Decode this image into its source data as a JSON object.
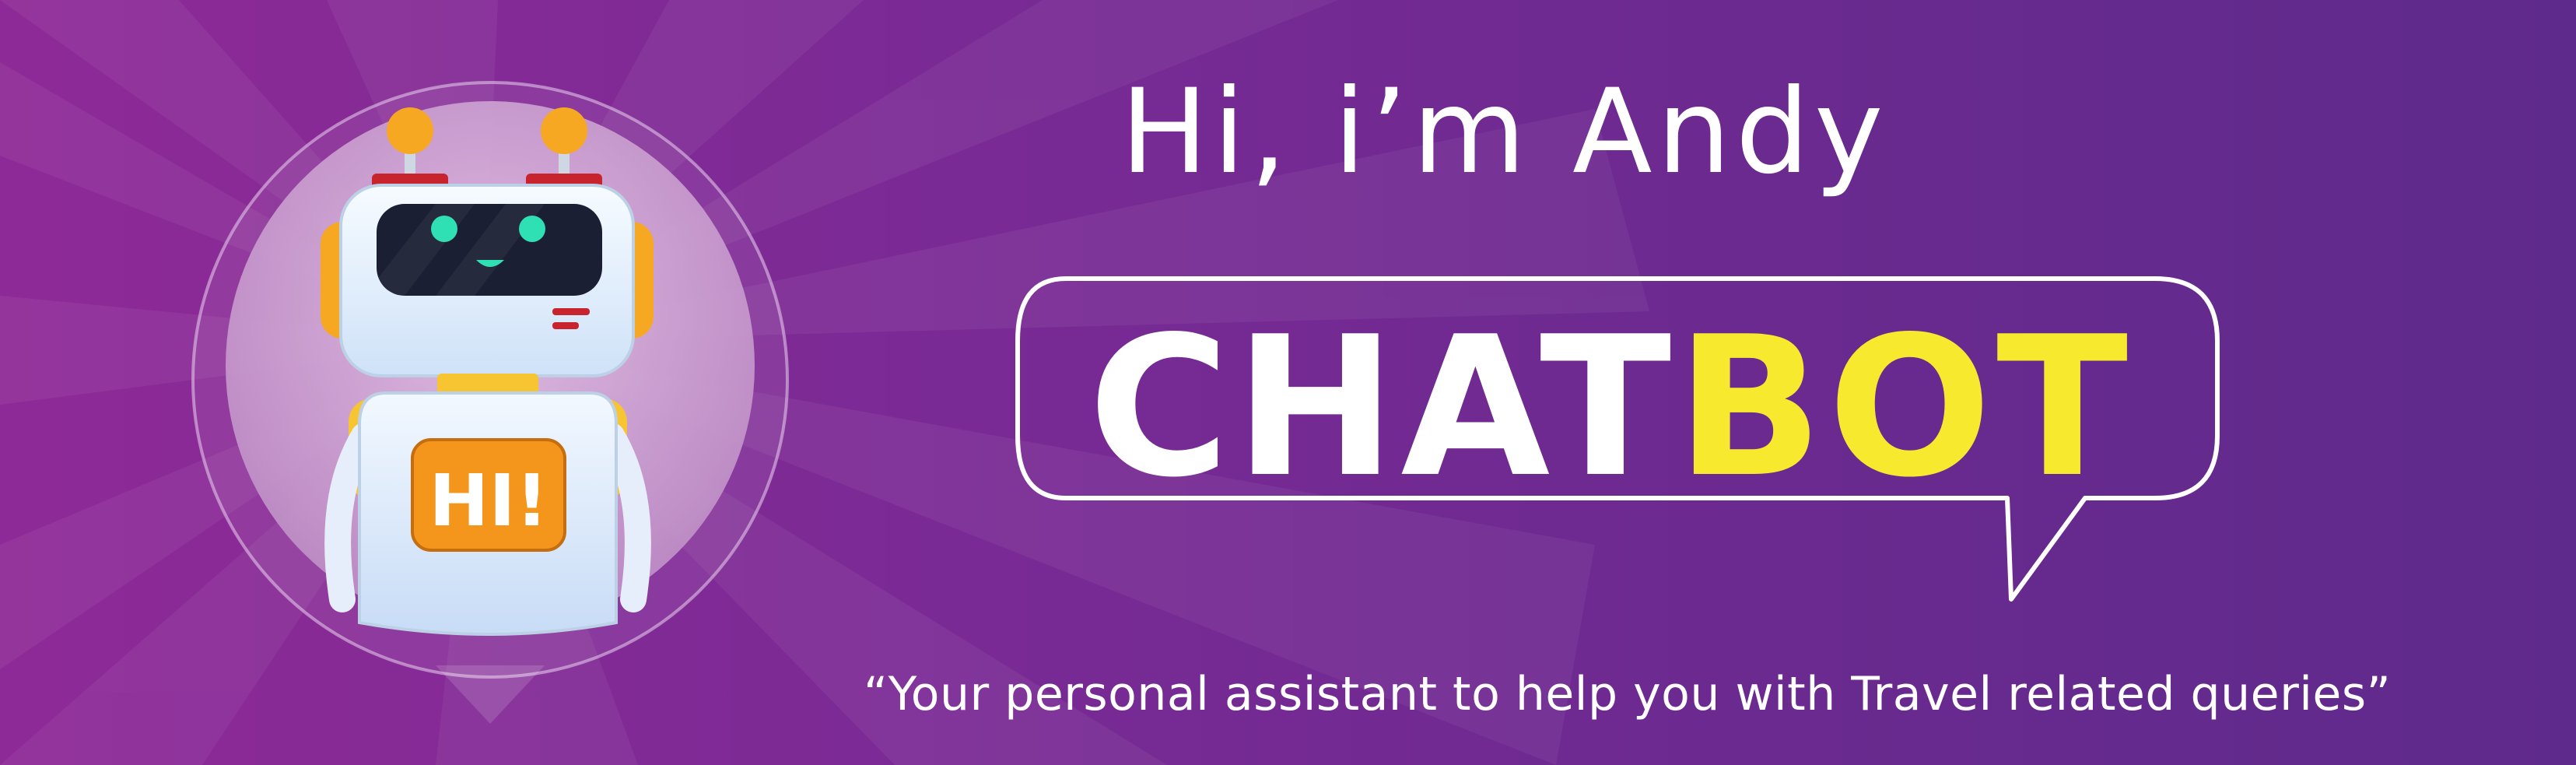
{
  "banner": {
    "greeting": "Hi, i’m Andy",
    "title_part1": "CHAT",
    "title_part2": "BOT",
    "tagline": "“Your personal assistant to help you with Travel related queries”",
    "badge_text": "HI!"
  },
  "colors": {
    "background": "#7b2a95",
    "accent_yellow": "#f7ea2e",
    "text": "#ffffff",
    "badge_orange": "#f5961c",
    "eye_teal": "#2ee0b4"
  },
  "icons": {
    "mascot": "robot-icon",
    "badge": "hi-badge-icon"
  }
}
